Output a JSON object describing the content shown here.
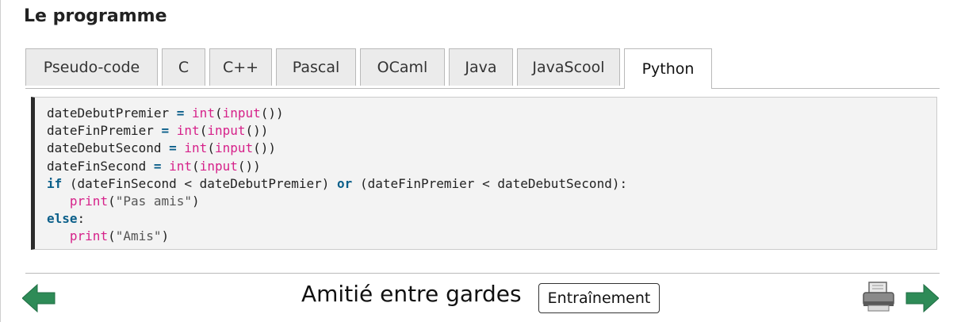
{
  "section": {
    "title": "Le programme"
  },
  "tabs": [
    {
      "label": "Pseudo-code",
      "active": false
    },
    {
      "label": "C",
      "active": false
    },
    {
      "label": "C++",
      "active": false
    },
    {
      "label": "Pascal",
      "active": false
    },
    {
      "label": "OCaml",
      "active": false
    },
    {
      "label": "Java",
      "active": false
    },
    {
      "label": "JavaScool",
      "active": false
    },
    {
      "label": "Python",
      "active": true
    }
  ],
  "code": {
    "language": "Python",
    "lines": [
      [
        {
          "t": "dateDebutPremier ",
          "c": "plain"
        },
        {
          "t": "=",
          "c": "op"
        },
        {
          "t": " ",
          "c": "plain"
        },
        {
          "t": "int",
          "c": "fn"
        },
        {
          "t": "(",
          "c": "plain"
        },
        {
          "t": "input",
          "c": "fn"
        },
        {
          "t": "())",
          "c": "plain"
        }
      ],
      [
        {
          "t": "dateFinPremier ",
          "c": "plain"
        },
        {
          "t": "=",
          "c": "op"
        },
        {
          "t": " ",
          "c": "plain"
        },
        {
          "t": "int",
          "c": "fn"
        },
        {
          "t": "(",
          "c": "plain"
        },
        {
          "t": "input",
          "c": "fn"
        },
        {
          "t": "())",
          "c": "plain"
        }
      ],
      [
        {
          "t": "dateDebutSecond ",
          "c": "plain"
        },
        {
          "t": "=",
          "c": "op"
        },
        {
          "t": " ",
          "c": "plain"
        },
        {
          "t": "int",
          "c": "fn"
        },
        {
          "t": "(",
          "c": "plain"
        },
        {
          "t": "input",
          "c": "fn"
        },
        {
          "t": "())",
          "c": "plain"
        }
      ],
      [
        {
          "t": "dateFinSecond ",
          "c": "plain"
        },
        {
          "t": "=",
          "c": "op"
        },
        {
          "t": " ",
          "c": "plain"
        },
        {
          "t": "int",
          "c": "fn"
        },
        {
          "t": "(",
          "c": "plain"
        },
        {
          "t": "input",
          "c": "fn"
        },
        {
          "t": "())",
          "c": "plain"
        }
      ],
      [
        {
          "t": "if",
          "c": "kw"
        },
        {
          "t": " (dateFinSecond < dateDebutPremier) ",
          "c": "plain"
        },
        {
          "t": "or",
          "c": "kw"
        },
        {
          "t": " (dateFinPremier < dateDebutSecond):",
          "c": "plain"
        }
      ],
      [
        {
          "t": "   ",
          "c": "plain"
        },
        {
          "t": "print",
          "c": "fn"
        },
        {
          "t": "(",
          "c": "plain"
        },
        {
          "t": "\"Pas amis\"",
          "c": "str"
        },
        {
          "t": ")",
          "c": "plain"
        }
      ],
      [
        {
          "t": "else",
          "c": "kw"
        },
        {
          "t": ":",
          "c": "plain"
        }
      ],
      [
        {
          "t": "   ",
          "c": "plain"
        },
        {
          "t": "print",
          "c": "fn"
        },
        {
          "t": "(",
          "c": "plain"
        },
        {
          "t": "\"Amis\"",
          "c": "str"
        },
        {
          "t": ")",
          "c": "plain"
        }
      ]
    ]
  },
  "footer": {
    "title": "Amitié entre gardes",
    "training_label": "Entraînement",
    "prev_icon": "arrow-left-icon",
    "next_icon": "arrow-right-icon",
    "print_icon": "printer-icon"
  },
  "colors": {
    "arrow_green": "#2e8b57",
    "keyword": "#0b5f8a",
    "function": "#d6228a",
    "code_bg": "#f3f3f3",
    "tab_inactive_bg": "#ebebeb"
  }
}
